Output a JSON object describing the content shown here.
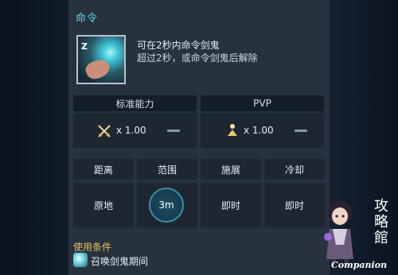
{
  "header": {
    "title": "命令"
  },
  "skill": {
    "icon_key": "Z",
    "icon": "summon-command-icon",
    "desc_line1": "可在2秒内命令剑鬼",
    "desc_line2": "超过2秒，或命令剑鬼后解除"
  },
  "modes": [
    {
      "label": "标准能力",
      "icon": "crossed-swords-icon",
      "value": "x 1.00"
    },
    {
      "label": "PVP",
      "icon": "pvp-figure-icon",
      "value": "x 1.00"
    }
  ],
  "attributes": {
    "headers": [
      "距离",
      "范围",
      "施展",
      "冷却"
    ],
    "values": [
      "原地",
      "3m",
      "即时",
      "即时"
    ]
  },
  "conditions": {
    "title": "使用条件",
    "icon": "sword-ghost-icon",
    "text": "召唤剑鬼期间"
  },
  "watermark": {
    "chars": "攻略館",
    "caption": "Companion"
  },
  "colors": {
    "accent": "#5fd3e4",
    "condition": "#e7c257",
    "panel": "#28323e"
  }
}
